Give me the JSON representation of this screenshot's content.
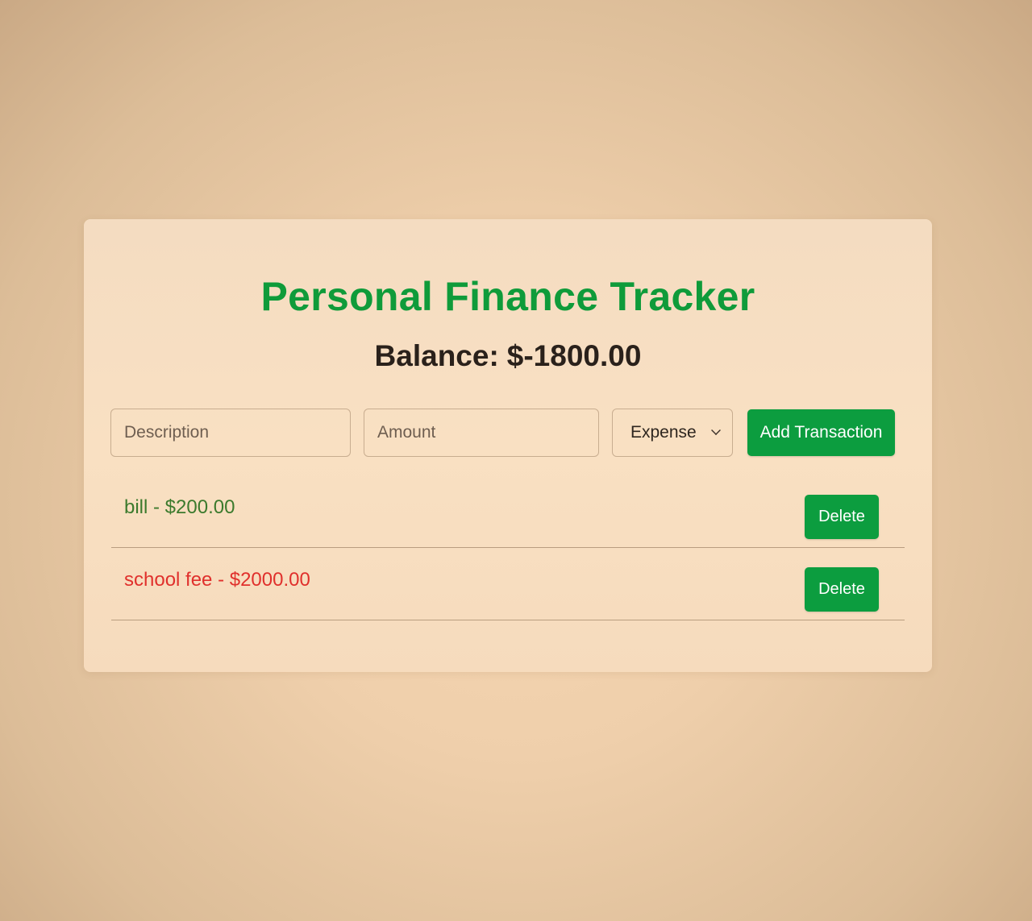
{
  "app": {
    "title": "Personal Finance Tracker"
  },
  "balance": {
    "label": "Balance:",
    "value": "$-1800.00"
  },
  "form": {
    "description_placeholder": "Description",
    "amount_placeholder": "Amount",
    "type_selected": "Expense",
    "add_button_label": "Add Transaction"
  },
  "transactions": [
    {
      "text": "bill - $200.00",
      "delete_label": "Delete"
    },
    {
      "text": "school fee - $2000.00",
      "delete_label": "Delete"
    }
  ],
  "colors": {
    "brand_green": "#0c9d3f",
    "income_text": "#3c7a2d",
    "expense_text": "#e0302c"
  }
}
